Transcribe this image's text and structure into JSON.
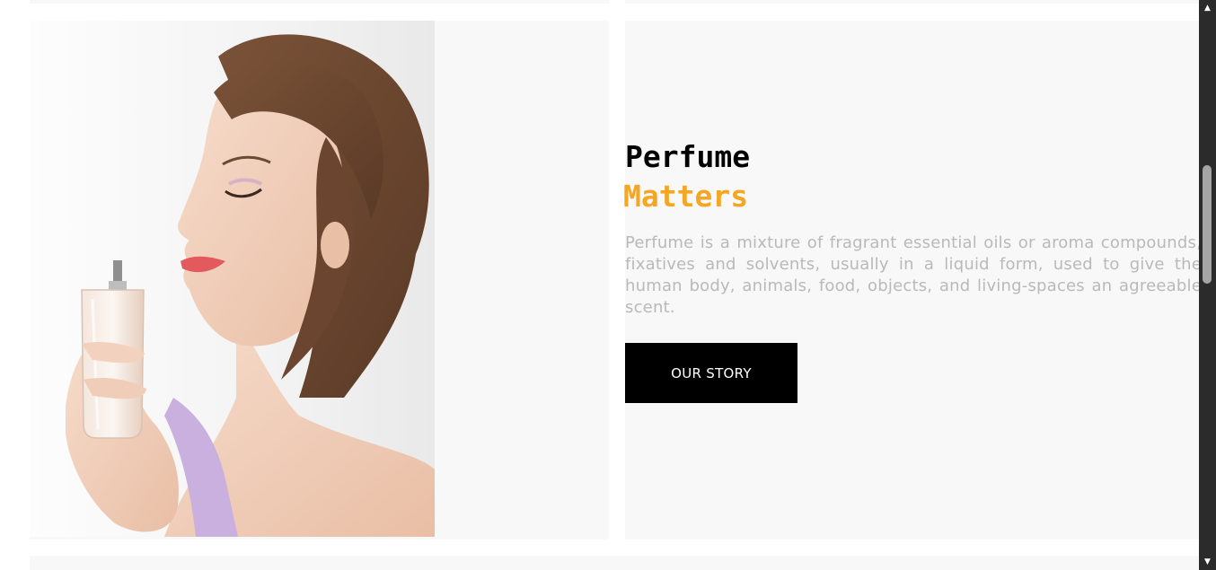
{
  "feature": {
    "heading_line1": "Perfume",
    "heading_line2": "Matters",
    "description": "Perfume is a mixture of fragrant essential oils or aroma compounds, fixatives and solvents, usually in a liquid form, used to give the human body, animals, food, objects, and living-spaces an agreeable scent.",
    "button_label": "OUR STORY",
    "accent_color": "#f5a623",
    "image_alt": "Woman smelling perfume bottle"
  },
  "scrollbar": {
    "up_icon": "triangle-up-icon",
    "down_icon": "triangle-down-icon"
  }
}
